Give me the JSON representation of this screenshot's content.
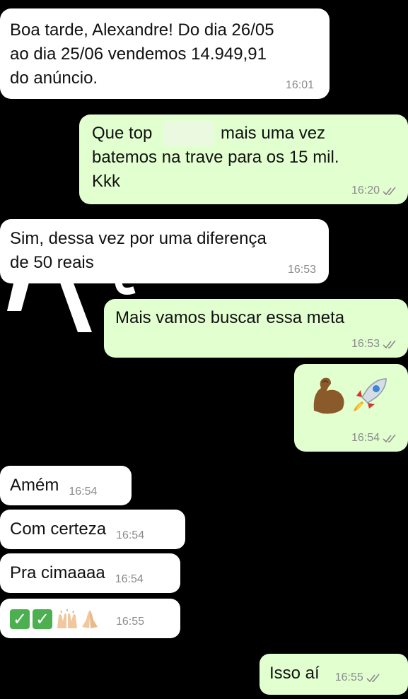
{
  "messages": [
    {
      "text": "Boa tarde, Alexandre! Do dia 26/05\nao dia 25/06 vendemos 14.949,91\ndo anúncio.",
      "time": "16:01"
    },
    {
      "text_part1": "Que top",
      "text_part2": "mais uma vez\nbatemos na trave para os 15 mil.\nKkk",
      "time": "16:20"
    },
    {
      "text": "Sim, dessa vez por uma diferença\nde 50 reais",
      "time": "16:53"
    },
    {
      "text": "Mais vamos buscar essa meta",
      "time": "16:53"
    },
    {
      "emojis": [
        "flexed-biceps",
        "rocket"
      ],
      "time": "16:54"
    },
    {
      "text": "Amém",
      "time": "16:54"
    },
    {
      "text": "Com certeza",
      "time": "16:54"
    },
    {
      "text": "Pra cimaaaa",
      "time": "16:54"
    },
    {
      "emojis": [
        "check-mark-button",
        "check-mark-button",
        "raising-hands",
        "folded-hands"
      ],
      "time": "16:55"
    },
    {
      "text": "Isso aí",
      "time": "16:55"
    }
  ],
  "colors": {
    "background": "#000000",
    "incoming_bubble": "#ffffff",
    "outgoing_bubble": "#e2ffd0",
    "timestamp": "#8a8a8a",
    "check_emoji": "#4caf50"
  }
}
